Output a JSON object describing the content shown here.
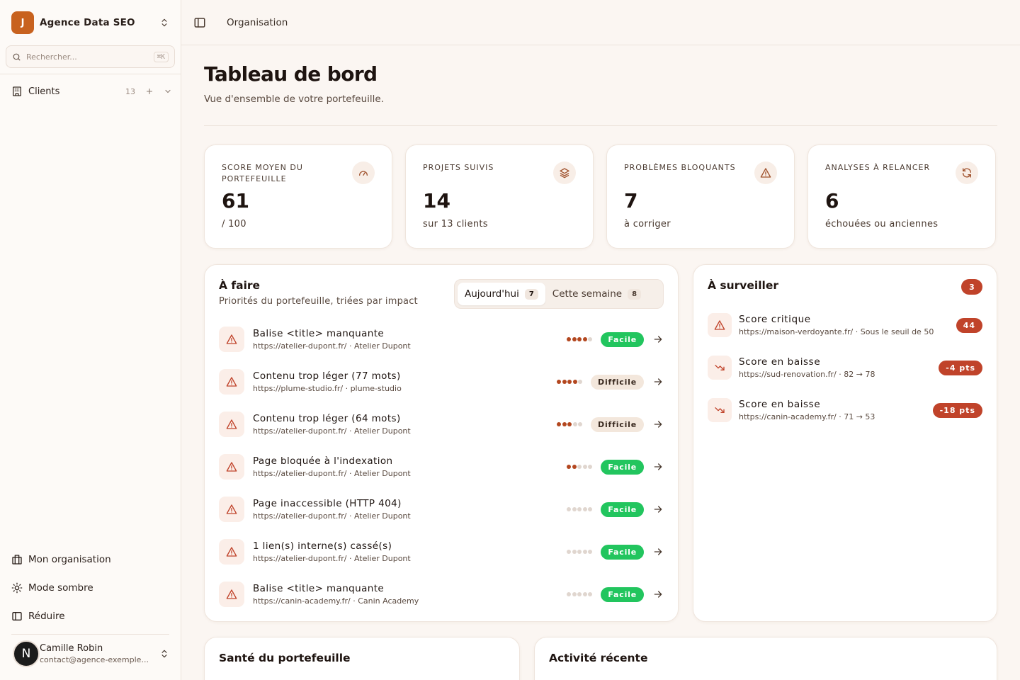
{
  "app": {
    "org_initial": "J",
    "org_name": "Agence Data SEO",
    "search_placeholder": "Rechercher...",
    "search_shortcut": "⌘K"
  },
  "sidebar": {
    "clients_label": "Clients",
    "clients_count": "13",
    "bottom_items": [
      {
        "label": "Mon organisation",
        "icon": "building-icon"
      },
      {
        "label": "Mode sombre",
        "icon": "sun-icon"
      },
      {
        "label": "Réduire",
        "icon": "sidebar-collapse-icon"
      }
    ],
    "user": {
      "initial": "N",
      "name": "Camille Robin",
      "email": "contact@agence-exemple..."
    }
  },
  "topbar": {
    "breadcrumb": "Organisation"
  },
  "header": {
    "title": "Tableau de bord",
    "subtitle": "Vue d'ensemble de votre portefeuille."
  },
  "stats": [
    {
      "label": "SCORE MOYEN DU PORTEFEUILLE",
      "value": "61",
      "sub": "/ 100",
      "icon": "gauge-icon"
    },
    {
      "label": "PROJETS SUIVIS",
      "value": "14",
      "sub": "sur 13 clients",
      "icon": "layers-icon"
    },
    {
      "label": "PROBLÈMES BLOQUANTS",
      "value": "7",
      "sub": "à corriger",
      "icon": "alert-icon"
    },
    {
      "label": "ANALYSES À RELANCER",
      "value": "6",
      "sub": "échouées ou anciennes",
      "icon": "refresh-icon"
    }
  ],
  "todo": {
    "title": "À faire",
    "subtitle": "Priorités du portefeuille, triées par impact",
    "tabs": [
      {
        "label": "Aujourd'hui",
        "count": "7",
        "active": true
      },
      {
        "label": "Cette semaine",
        "count": "8",
        "active": false
      }
    ],
    "items": [
      {
        "title": "Balise <title> manquante",
        "meta": "https://atelier-dupont.fr/ · Atelier Dupont",
        "impact": 4,
        "difficulty": "Facile",
        "level": "easy"
      },
      {
        "title": "Contenu trop léger (77 mots)",
        "meta": "https://plume-studio.fr/ · plume-studio",
        "impact": 4,
        "difficulty": "Difficile",
        "level": "hard"
      },
      {
        "title": "Contenu trop léger (64 mots)",
        "meta": "https://atelier-dupont.fr/ · Atelier Dupont",
        "impact": 3,
        "difficulty": "Difficile",
        "level": "hard"
      },
      {
        "title": "Page bloquée à l'indexation",
        "meta": "https://atelier-dupont.fr/ · Atelier Dupont",
        "impact": 2,
        "difficulty": "Facile",
        "level": "easy"
      },
      {
        "title": "Page inaccessible (HTTP 404)",
        "meta": "https://atelier-dupont.fr/ · Atelier Dupont",
        "impact": 0,
        "difficulty": "Facile",
        "level": "easy"
      },
      {
        "title": "1 lien(s) interne(s) cassé(s)",
        "meta": "https://atelier-dupont.fr/ · Atelier Dupont",
        "impact": 0,
        "difficulty": "Facile",
        "level": "easy"
      },
      {
        "title": "Balise <title> manquante",
        "meta": "https://canin-academy.fr/ · Canin Academy",
        "impact": 0,
        "difficulty": "Facile",
        "level": "easy"
      }
    ]
  },
  "watch": {
    "title": "À surveiller",
    "count": "3",
    "items": [
      {
        "title": "Score critique",
        "meta": "https://maison-verdoyante.fr/ · Sous le seuil de 50",
        "badge": "44",
        "icon": "alert-icon"
      },
      {
        "title": "Score en baisse",
        "meta": "https://sud-renovation.fr/ · 82 → 78",
        "badge": "-4 pts",
        "icon": "trending-down-icon"
      },
      {
        "title": "Score en baisse",
        "meta": "https://canin-academy.fr/ · 71 → 53",
        "badge": "-18 pts",
        "icon": "trending-down-icon"
      }
    ]
  },
  "sections": {
    "health_title": "Santé du portefeuille",
    "activity_title": "Activité récente"
  },
  "colors": {
    "accent": "#c8621f",
    "danger": "#c0432a",
    "success": "#22c55e",
    "background": "#fbf6f2"
  }
}
